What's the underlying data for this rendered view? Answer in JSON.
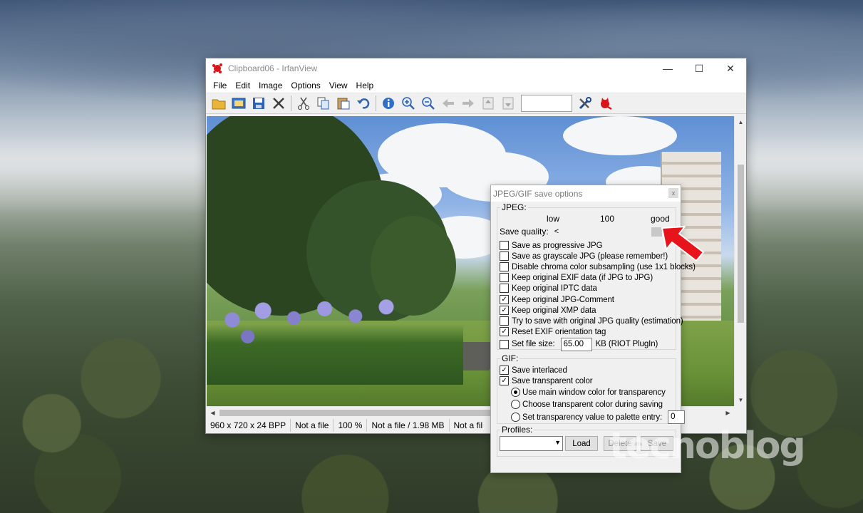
{
  "window": {
    "title": "Clipboard06 - IrfanView",
    "controls": {
      "minimize": "—",
      "maximize": "☐",
      "close": "✕"
    }
  },
  "menu": [
    "File",
    "Edit",
    "Image",
    "Options",
    "View",
    "Help"
  ],
  "toolbar": {
    "icons": [
      "open-folder-icon",
      "slideshow-icon",
      "save-icon",
      "delete-icon",
      "cut-icon",
      "copy-icon",
      "paste-icon",
      "undo-icon",
      "info-icon",
      "zoom-in-icon",
      "zoom-out-icon",
      "previous-icon",
      "next-icon",
      "first-page-icon",
      "last-page-icon",
      "settings-icon",
      "irfanview-cat-icon"
    ],
    "page_input_value": ""
  },
  "status": {
    "dimensions": "960 x 720 x 24 BPP",
    "file1": "Not a file",
    "zoom": "100 %",
    "file_size": "Not a file / 1.98 MB",
    "file2": "Not a fil"
  },
  "dialog": {
    "title": "JPEG/GIF save options",
    "close": "x",
    "jpeg": {
      "group_label": "JPEG:",
      "label_low": "low",
      "label_value": "100",
      "label_good": "good",
      "quality_label": "Save quality:",
      "quality_value": 100,
      "quality_max": 100,
      "options": [
        {
          "label": "Save as progressive JPG",
          "checked": false
        },
        {
          "label": "Save as grayscale JPG (please remember!)",
          "checked": false
        },
        {
          "label": "Disable chroma color subsampling (use 1x1 blocks)",
          "checked": false
        },
        {
          "label": "Keep original EXIF data (if JPG to JPG)",
          "checked": false
        },
        {
          "label": "Keep original IPTC data",
          "checked": false
        },
        {
          "label": "Keep original JPG-Comment",
          "checked": true
        },
        {
          "label": "Keep original XMP data",
          "checked": true
        },
        {
          "label": "Try to save with original JPG quality (estimation)",
          "checked": false
        },
        {
          "label": "Reset EXIF orientation tag",
          "checked": true
        }
      ],
      "file_size": {
        "label": "Set file size:",
        "checked": false,
        "value": "65.00",
        "unit": "KB (RIOT PlugIn)"
      }
    },
    "gif": {
      "group_label": "GIF:",
      "save_interlaced": {
        "label": "Save interlaced",
        "checked": true
      },
      "save_transparent": {
        "label": "Save transparent color",
        "checked": true
      },
      "radios": [
        {
          "label": "Use main window color for transparency",
          "selected": true
        },
        {
          "label": "Choose transparent color during saving",
          "selected": false
        },
        {
          "label": "Set transparency value to palette entry:",
          "selected": false
        }
      ],
      "palette_entry": "0"
    },
    "profiles": {
      "group_label": "Profiles:",
      "selected": "",
      "load": "Load",
      "delete": "Delete",
      "save": "Save"
    }
  },
  "watermark": "tecnoblog",
  "colors": {
    "highlight_arrow": "#e8141b",
    "window_bg": "#f0f0f0"
  }
}
